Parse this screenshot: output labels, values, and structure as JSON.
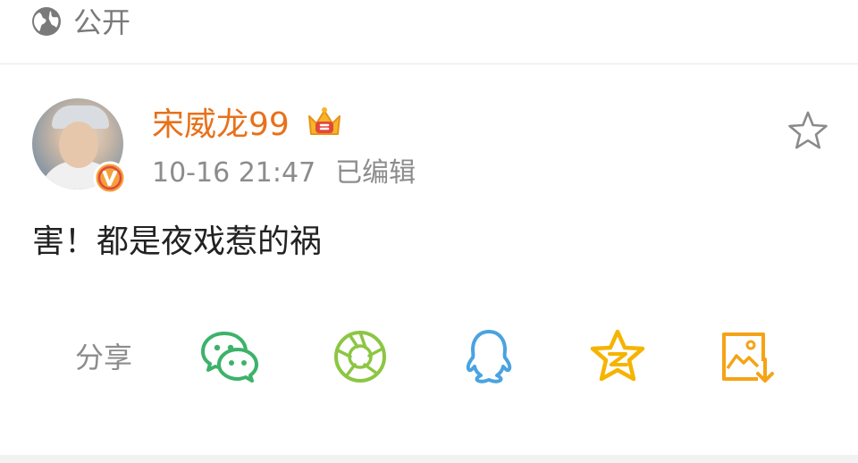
{
  "visibility": {
    "label": "公开",
    "icon": "globe-icon"
  },
  "post": {
    "author": "宋威龙99",
    "timestamp": "10-16 21:47",
    "edited_label": "已编辑",
    "text": "害！都是夜戏惹的祸",
    "avatar_icon": "avatar",
    "verified_icon": "verified-v-badge-icon",
    "member_icon": "crown-icon",
    "favorite_icon": "star-outline-icon"
  },
  "share": {
    "label": "分享",
    "targets": [
      {
        "name": "wechat-icon",
        "color": "#3db26a"
      },
      {
        "name": "moments-icon",
        "color": "#8cc643"
      },
      {
        "name": "qq-icon",
        "color": "#4aa3e0"
      },
      {
        "name": "qzone-icon",
        "color": "#f5b400"
      },
      {
        "name": "save-image-icon",
        "color": "#f5a316"
      }
    ]
  },
  "colors": {
    "username": "#e8711a",
    "text": "#222222",
    "muted": "#8c8c8c"
  }
}
